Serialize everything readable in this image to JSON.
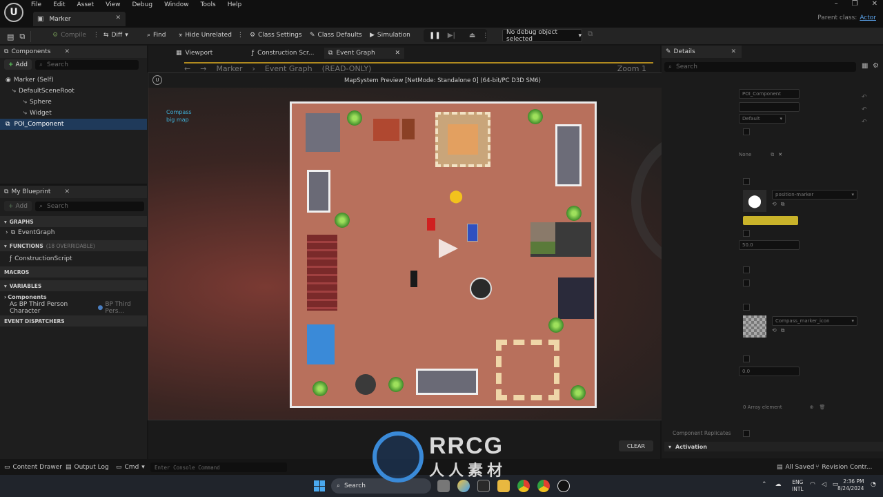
{
  "app": {
    "logo": "U",
    "menu": [
      "File",
      "Edit",
      "Asset",
      "View",
      "Debug",
      "Window",
      "Tools",
      "Help"
    ],
    "doc_tab": "Marker",
    "parent_class_label": "Parent class:",
    "parent_class_value": "Actor"
  },
  "toolbar": {
    "compile": "Compile",
    "diff": "Diff",
    "find": "Find",
    "hide_unrelated": "Hide Unrelated",
    "class_settings": "Class Settings",
    "class_defaults": "Class Defaults",
    "simulation": "Simulation",
    "debug_object": "No debug object selected"
  },
  "components_panel": {
    "title": "Components",
    "add": "Add",
    "search_placeholder": "Search",
    "tree": [
      "Marker (Self)",
      "DefaultSceneRoot",
      "Sphere",
      "Widget",
      "POI_Component"
    ]
  },
  "editor_tabs": [
    "Viewport",
    "Construction Scr...",
    "Event Graph"
  ],
  "graph_header": {
    "marker": "Marker",
    "event_graph": "Event Graph",
    "readonly": "(READ-ONLY)",
    "zoom": "Zoom 1"
  },
  "blueprint_panel": {
    "title": "My Blueprint",
    "add": "Add",
    "search_placeholder": "Search",
    "graphs": "GRAPHS",
    "event_graph": "EventGraph",
    "functions": "FUNCTIONS",
    "functions_count": "(18 OVERRIDABLE)",
    "construction_script": "ConstructionScript",
    "macros": "MACROS",
    "variables": "VARIABLES",
    "components": "Components",
    "var_name": "As BP Third Person Character",
    "var_type": "BP Third Pers...",
    "event_dispatchers": "EVENT DISPATCHERS"
  },
  "preview": {
    "title": "MapSystem Preview [NetMode: Standalone 0]  (64-bit/PC D3D SM6)",
    "compass_line1": "Compass",
    "compass_line2": "big map"
  },
  "details": {
    "title": "Details",
    "search_placeholder": "Search",
    "name_field": "POI_Component",
    "default_option": "Default",
    "none_value": "None",
    "position_marker": "position-marker",
    "color": "#c9b32a",
    "value_50": "50.0",
    "compass_icon": "Compass_marker_icon",
    "value_0": "0.0",
    "array_elements": "0 Array element",
    "component_replicates": "Component Replicates",
    "activation": "Activation"
  },
  "clear_button": "CLEAR",
  "statusbar": {
    "content_drawer": "Content Drawer",
    "output_log": "Output Log",
    "cmd": "Cmd",
    "console_placeholder": "Enter Console Command",
    "all_saved": "All Saved",
    "revision_control": "Revision Contr..."
  },
  "taskbar": {
    "search": "Search",
    "lang1": "ENG",
    "lang2": "INTL",
    "time": "2:36 PM",
    "date": "8/24/2024"
  },
  "watermark": {
    "brand": "RRCG",
    "sub": "人人素材"
  }
}
